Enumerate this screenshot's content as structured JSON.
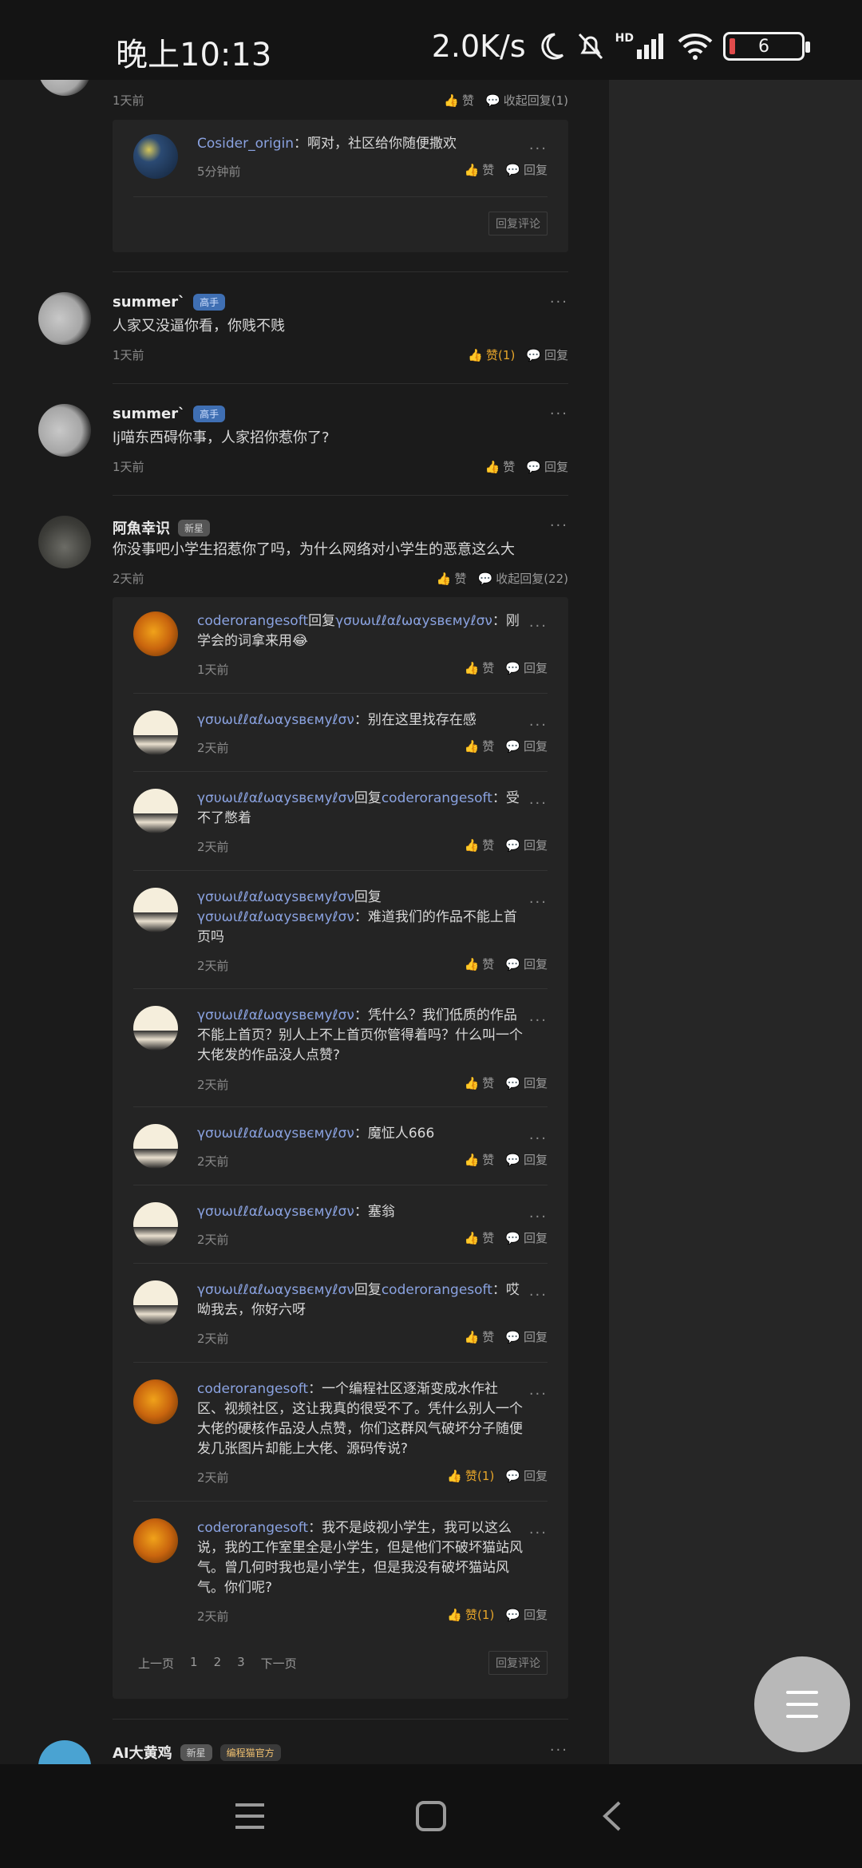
{
  "status": {
    "time": "晚上10:13",
    "net_speed": "2.0K/s",
    "battery": "6",
    "hd": "HD"
  },
  "labels": {
    "like": "赞",
    "reply": "回复",
    "collapse": "收起回复",
    "reply_comment": "回复评论",
    "more": "···",
    "colon": "："
  },
  "top_comment": {
    "meta": "1天前",
    "collapse_label": "收起回复(1)",
    "sub": {
      "user": "Cosider_origin",
      "text": "啊对，社区给你随便撒欢",
      "time": "5分钟前"
    }
  },
  "comments": [
    {
      "user": "summer`",
      "badge": "高手",
      "text": "人家又没逼你看，你贱不贱",
      "time": "1天前",
      "like_label": "赞(1)"
    },
    {
      "user": "summer`",
      "badge": "高手",
      "text": "lj喵东西碍你事，人家招你惹你了?",
      "time": "1天前",
      "like_label": "赞"
    },
    {
      "user": "阿魚幸识",
      "badge": "新星",
      "text": "你没事吧小学生招惹你了吗，为什么网络对小学生的恶意这么大",
      "time": "2天前",
      "like_label": "赞",
      "collapse_label": "收起回复(22)"
    }
  ],
  "replies": [
    {
      "user": "coderorangesoft",
      "reply_word": "回复",
      "target": "γσυωιℓℓαℓωαуѕвємуℓσν",
      "text": "刚学会的词拿来用😂",
      "time": "1天前",
      "like_label": "赞"
    },
    {
      "user": "γσυωιℓℓαℓωαуѕвємуℓσν",
      "reply_word": "",
      "target": "",
      "text": "别在这里找存在感",
      "time": "2天前",
      "like_label": "赞"
    },
    {
      "user": "γσυωιℓℓαℓωαуѕвємуℓσν",
      "reply_word": "回复",
      "target": "coderorangesoft",
      "text": "受不了憋着",
      "time": "2天前",
      "like_label": "赞"
    },
    {
      "user": "γσυωιℓℓαℓωαуѕвємуℓσν",
      "reply_word": "回复",
      "target": "γσυωιℓℓαℓωαуѕвємуℓσν",
      "text": "难道我们的作品不能上首页吗",
      "time": "2天前",
      "like_label": "赞"
    },
    {
      "user": "γσυωιℓℓαℓωαуѕвємуℓσν",
      "reply_word": "",
      "target": "",
      "text": "凭什么？我们低质的作品不能上首页？别人上不上首页你管得着吗？什么叫一个大佬发的作品没人点赞?",
      "time": "2天前",
      "like_label": "赞"
    },
    {
      "user": "γσυωιℓℓαℓωαуѕвємуℓσν",
      "reply_word": "",
      "target": "",
      "text": "魔怔人666",
      "time": "2天前",
      "like_label": "赞"
    },
    {
      "user": "γσυωιℓℓαℓωαуѕвємуℓσν",
      "reply_word": "",
      "target": "",
      "text": "塞翁",
      "time": "2天前",
      "like_label": "赞"
    },
    {
      "user": "γσυωιℓℓαℓωαуѕвємуℓσν",
      "reply_word": "回复",
      "target": "coderorangesoft",
      "text": "哎呦我去，你好六呀",
      "time": "2天前",
      "like_label": "赞"
    },
    {
      "user": "coderorangesoft",
      "reply_word": "",
      "target": "",
      "text": "一个编程社区逐渐变成水作社区、视频社区，这让我真的很受不了。凭什么别人一个大佬的硬核作品没人点赞，你们这群风气破坏分子随便发几张图片却能上大佬、源码传说?",
      "time": "2天前",
      "like_label": "赞(1)"
    },
    {
      "user": "coderorangesoft",
      "reply_word": "",
      "target": "",
      "text": "我不是歧视小学生，我可以这么说，我的工作室里全是小学生，但是他们不破坏猫站风气。曾几何时我也是小学生，但是我没有破坏猫站风气。你们呢?",
      "time": "2天前",
      "like_label": "赞(1)"
    }
  ],
  "pagination": {
    "prev": "上一页",
    "p1": "1",
    "p2": "2",
    "p3": "3",
    "next": "下一页"
  },
  "last_comment": {
    "user": "AI大黄鸡",
    "badge": "新星",
    "official": "编程猫官方"
  },
  "colors": {
    "accent_link": "#8aa2e0",
    "like_active": "#e6a52a"
  }
}
